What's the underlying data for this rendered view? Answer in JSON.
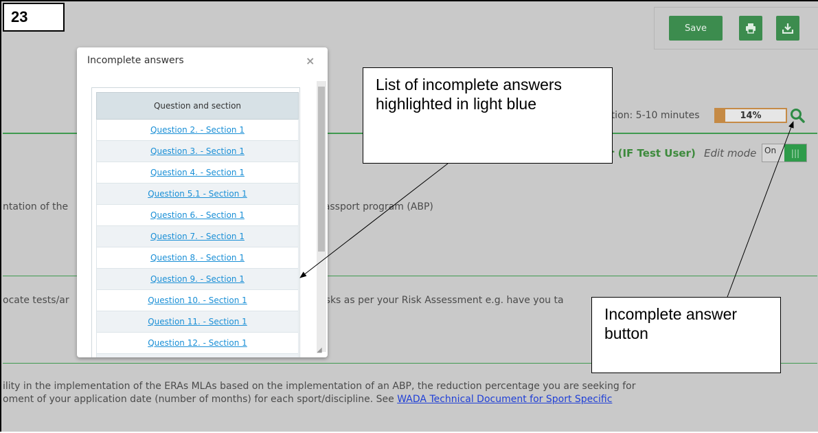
{
  "step": {
    "number": "23"
  },
  "toolbar": {
    "save_label": "Save",
    "print_icon": "print-icon",
    "download_icon": "download-icon"
  },
  "progress": {
    "label": "ction: 5-10 minutes",
    "percent_text": "14%",
    "percent_value": 14,
    "search_icon": "search-icon"
  },
  "user": {
    "label": "r (IF Test User)"
  },
  "edit_mode": {
    "label": "Edit mode",
    "toggle_label": "On"
  },
  "background_text": {
    "line1_left": "ntation of the",
    "line1_right": "Passport program (ABP)",
    "line2_left": "ocate tests/ar",
    "line2_right": "risks as per your Risk Assessment e.g. have you ta",
    "line3": "ility in the implementation of the ERAs MLAs based on the implementation of an ABP, the reduction percentage you are seeking for",
    "line4_text": "oment of your application date (number of months) for each sport/discipline. See ",
    "line4_link": "WADA Technical Document for Sport Specific"
  },
  "modal": {
    "title": "Incomplete answers",
    "close_icon": "close-icon",
    "column_header": "Question and section",
    "rows": [
      "Question 2. - Section 1",
      "Question 3. - Section 1",
      "Question 4. - Section 1",
      "Question 5.1 - Section 1",
      "Question 6. - Section 1",
      "Question 7. - Section 1",
      "Question 8. - Section 1",
      "Question 9. - Section 1",
      "Question 10. - Section 1",
      "Question 11. - Section 1",
      "Question 12. - Section 1"
    ]
  },
  "callouts": {
    "list": "List of incomplete answers highlighted in light blue",
    "button": "Incomplete answer button"
  },
  "colors": {
    "accent_green": "#3c8c4e",
    "progress_orange": "#c58a45",
    "link_blue": "#1a8fd6",
    "overlay_gray": "#c9c9c9"
  }
}
